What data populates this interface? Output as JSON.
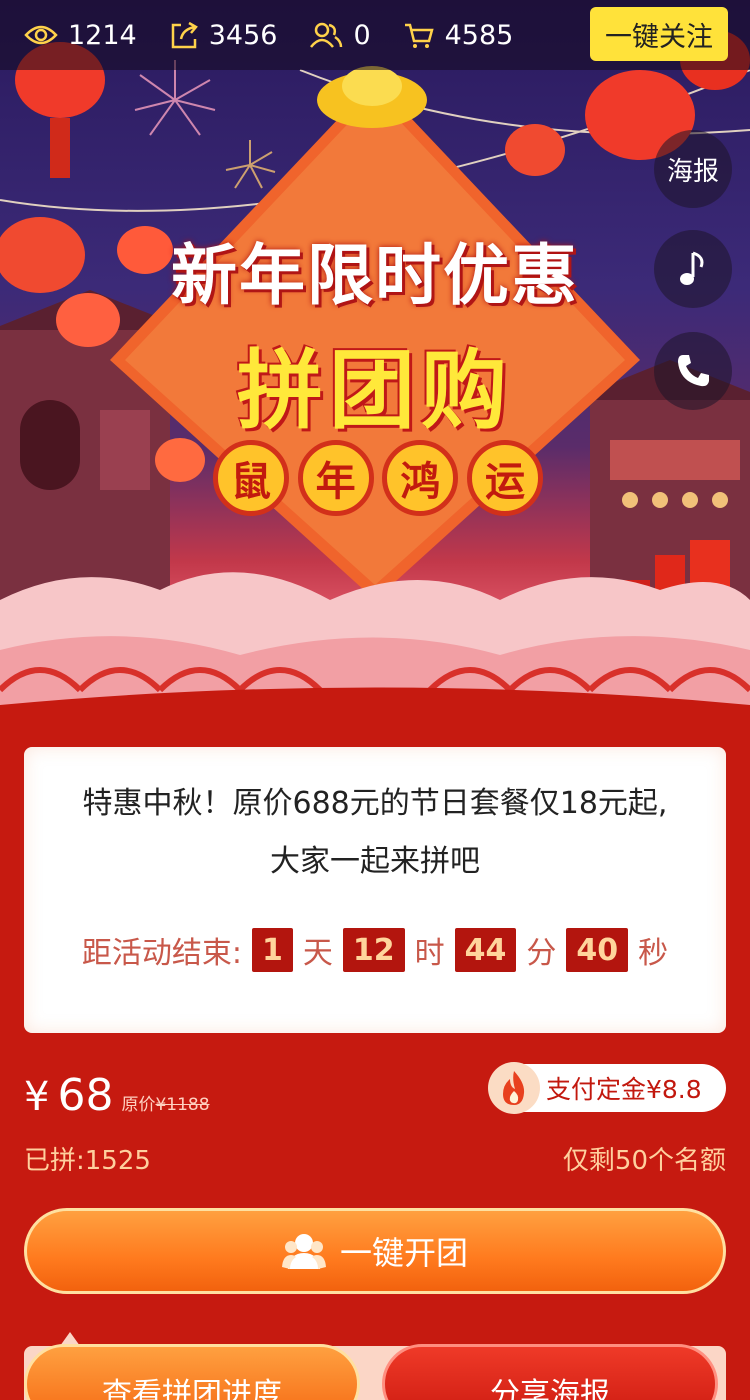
{
  "stats": {
    "views": "1214",
    "shares": "3456",
    "participants": "0",
    "orders": "4585"
  },
  "follow_label": "一键关注",
  "float": {
    "poster_label": "海报"
  },
  "hero": {
    "title": "新年限时优惠",
    "subtitle": "拼团购",
    "badges": [
      "鼠",
      "年",
      "鸿",
      "运"
    ]
  },
  "info": {
    "desc_line1": "特惠中秋！原价688元的节日套餐仅18元起,",
    "desc_line2": "大家一起来拼吧",
    "countdown_label": "距活动结束:",
    "days": "1",
    "days_unit": "天",
    "hours": "12",
    "hours_unit": "时",
    "minutes": "44",
    "minutes_unit": "分",
    "seconds": "40",
    "seconds_unit": "秒"
  },
  "price": {
    "symbol": "¥",
    "value": "68",
    "original_label": "原价",
    "original_value": "¥1188"
  },
  "deposit_label": "支付定金¥8.8",
  "joined_label": "已拼:1525",
  "remaining_label": "仅剩50个名额",
  "main_button": "一键开团",
  "progress_button": "查看拼团进度",
  "share_button": "分享海报",
  "colors": {
    "accent_yellow": "#ffe23a",
    "page_red": "#c61a10",
    "countdown_box": "#b3150e",
    "button_orange": "#ff7a1e"
  }
}
